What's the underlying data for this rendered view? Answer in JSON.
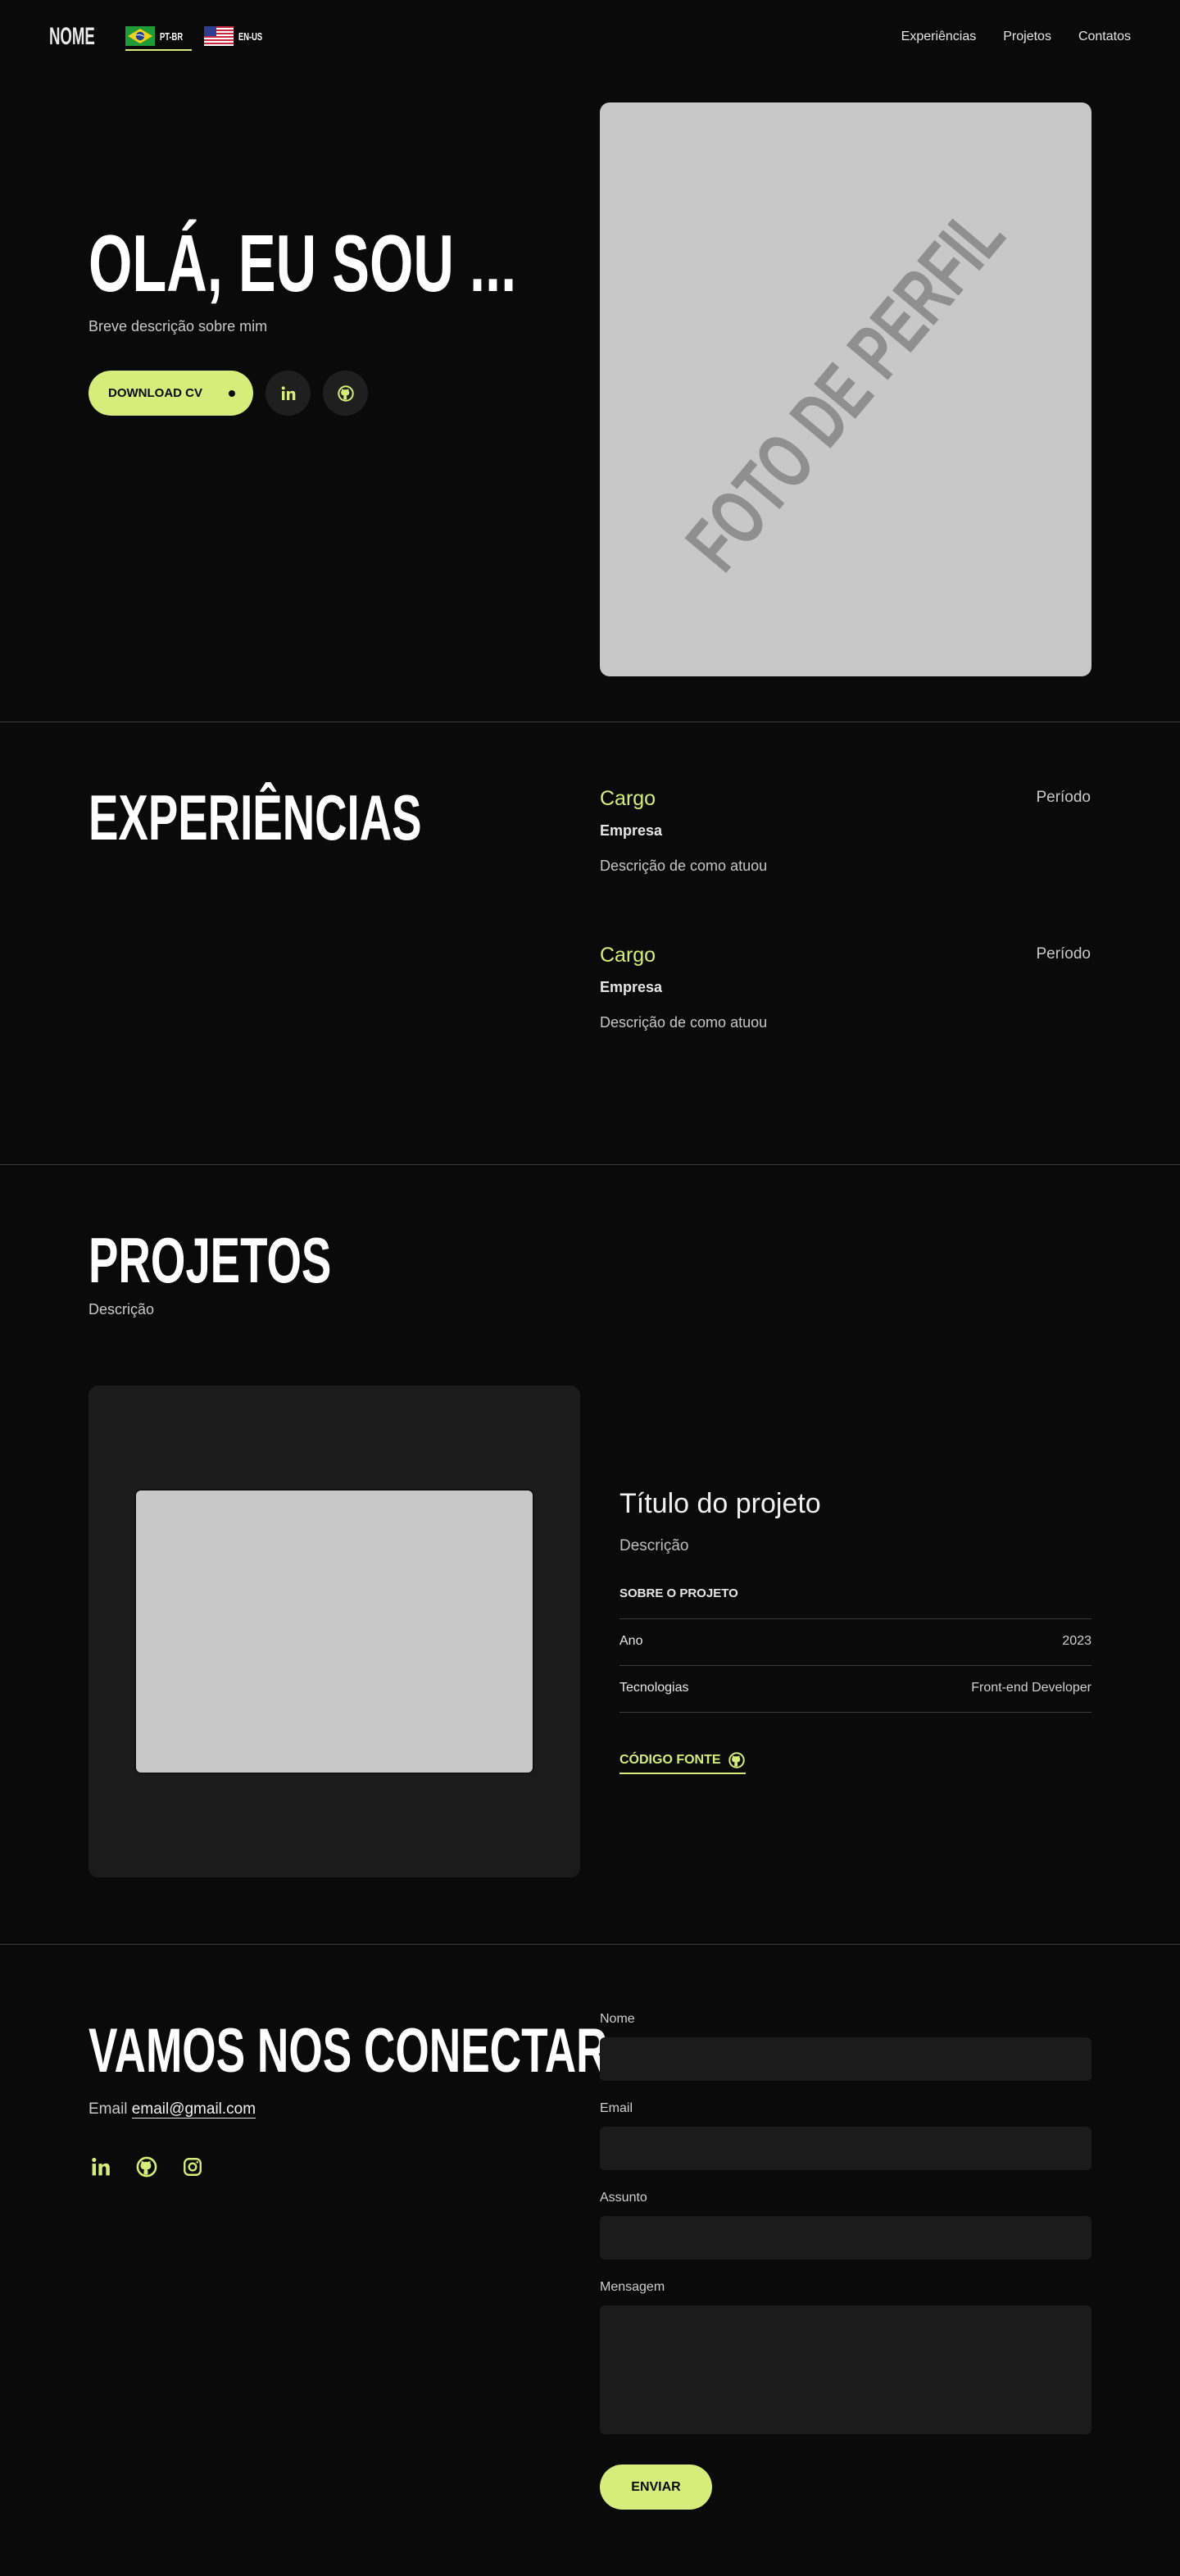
{
  "header": {
    "logo": "NOME",
    "languages": [
      {
        "label": "PT-BR",
        "active": true
      },
      {
        "label": "EN-US",
        "active": false
      }
    ],
    "nav": [
      "Experiências",
      "Projetos",
      "Contatos"
    ]
  },
  "hero": {
    "title": "OLÁ, EU SOU ...",
    "description": "Breve descrição sobre mim",
    "download_label": "DOWNLOAD CV",
    "photo_placeholder": "FOTO DE PERFIL",
    "social_icons": [
      "linkedin-icon",
      "github-icon"
    ]
  },
  "experience": {
    "title": "EXPERIÊNCIAS",
    "items": [
      {
        "cargo": "Cargo",
        "periodo": "Período",
        "empresa": "Empresa",
        "descricao": "Descrição de como atuou"
      },
      {
        "cargo": "Cargo",
        "periodo": "Período",
        "empresa": "Empresa",
        "descricao": "Descrição de como atuou"
      }
    ]
  },
  "projects": {
    "title": "PROJETOS",
    "description": "Descrição",
    "item": {
      "title": "Título do projeto",
      "description": "Descrição",
      "about_label": "SOBRE O PROJETO",
      "rows": [
        {
          "key": "Ano",
          "value": "2023"
        },
        {
          "key": "Tecnologias",
          "value": "Front-end Developer"
        }
      ],
      "source_label": "CÓDIGO FONTE"
    }
  },
  "contact": {
    "title": "VAMOS NOS CONECTAR",
    "email_label": "Email",
    "email": "email@gmail.com",
    "icons": [
      "linkedin-icon",
      "github-icon",
      "instagram-icon"
    ],
    "form": {
      "name_label": "Nome",
      "email_label": "Email",
      "subject_label": "Assunto",
      "message_label": "Mensagem",
      "submit_label": "ENVIAR"
    }
  },
  "colors": {
    "background": "#0a0a0a",
    "accent": "#d7ec7a",
    "card": "#1b1b1b",
    "placeholder": "#c8c8c8"
  }
}
